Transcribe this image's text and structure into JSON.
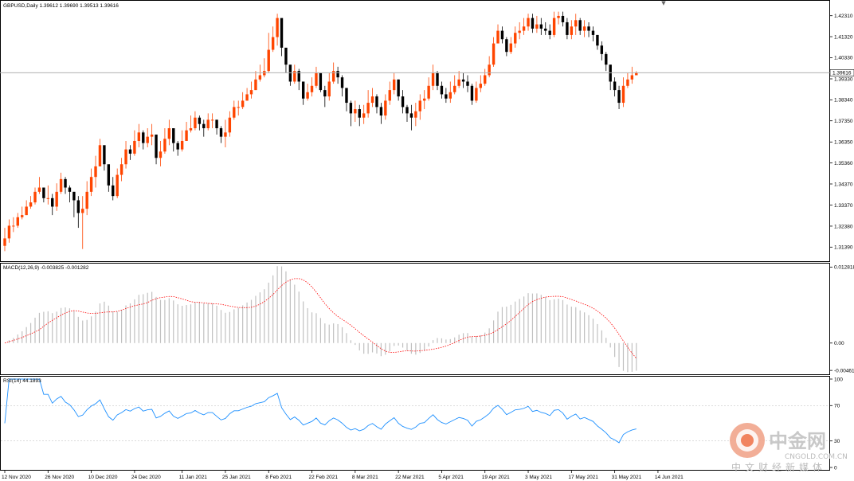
{
  "chart_data": [
    {
      "type": "candlestick",
      "title": "GBPUSD,Daily  1.39612 1.39690 1.39513 1.39616",
      "current_price": 1.39616,
      "current_price_label": "1.39616",
      "ylim": [
        1.308,
        1.429
      ],
      "y_ticks": [
        "1.42310",
        "1.41320",
        "1.40330",
        "1.39330",
        "1.38340",
        "1.37350",
        "1.36350",
        "1.35360",
        "1.34370",
        "1.33370",
        "1.32380",
        "1.31390"
      ],
      "x_ticks": [
        {
          "i": 0,
          "label": "12 Nov 2020"
        },
        {
          "i": 10,
          "label": "26 Nov 2020"
        },
        {
          "i": 20,
          "label": "10 Dec 2020"
        },
        {
          "i": 30,
          "label": "24 Dec 2020"
        },
        {
          "i": 41,
          "label": "11 Jan 2021"
        },
        {
          "i": 51,
          "label": "25 Jan 2021"
        },
        {
          "i": 61,
          "label": "8 Feb 2021"
        },
        {
          "i": 71,
          "label": "22 Feb 2021"
        },
        {
          "i": 81,
          "label": "8 Mar 2021"
        },
        {
          "i": 91,
          "label": "22 Mar 2021"
        },
        {
          "i": 101,
          "label": "5 Apr 2021"
        },
        {
          "i": 111,
          "label": "19 Apr 2021"
        },
        {
          "i": 121,
          "label": "3 May 2021"
        },
        {
          "i": 131,
          "label": "17 May 2021"
        },
        {
          "i": 141,
          "label": "31 May 2021"
        },
        {
          "i": 151,
          "label": "14 Jun 2021"
        }
      ],
      "closes": [
        1.318,
        1.324,
        1.324,
        1.328,
        1.329,
        1.333,
        1.335,
        1.34,
        1.342,
        1.337,
        1.337,
        1.333,
        1.34,
        1.346,
        1.342,
        1.34,
        1.336,
        1.33,
        1.332,
        1.34,
        1.347,
        1.352,
        1.362,
        1.353,
        1.343,
        1.338,
        1.348,
        1.353,
        1.36,
        1.358,
        1.364,
        1.368,
        1.363,
        1.366,
        1.367,
        1.356,
        1.359,
        1.365,
        1.37,
        1.363,
        1.36,
        1.364,
        1.369,
        1.37,
        1.375,
        1.372,
        1.37,
        1.374,
        1.374,
        1.37,
        1.366,
        1.368,
        1.375,
        1.38,
        1.38,
        1.383,
        1.386,
        1.388,
        1.393,
        1.395,
        1.397,
        1.407,
        1.413,
        1.422,
        1.408,
        1.4,
        1.392,
        1.397,
        1.392,
        1.384,
        1.387,
        1.39,
        1.396,
        1.388,
        1.385,
        1.392,
        1.397,
        1.394,
        1.389,
        1.382,
        1.377,
        1.379,
        1.375,
        1.377,
        1.382,
        1.385,
        1.38,
        1.376,
        1.383,
        1.388,
        1.393,
        1.385,
        1.38,
        1.377,
        1.375,
        1.378,
        1.383,
        1.384,
        1.39,
        1.396,
        1.39,
        1.386,
        1.384,
        1.387,
        1.39,
        1.393,
        1.392,
        1.39,
        1.383,
        1.389,
        1.391,
        1.395,
        1.4,
        1.41,
        1.416,
        1.412,
        1.406,
        1.41,
        1.415,
        1.416,
        1.418,
        1.422,
        1.417,
        1.419,
        1.417,
        1.416,
        1.414,
        1.422,
        1.423,
        1.42,
        1.414,
        1.418,
        1.421,
        1.416,
        1.418,
        1.416,
        1.414,
        1.409,
        1.405,
        1.4,
        1.392,
        1.388,
        1.382,
        1.39,
        1.393,
        1.395,
        1.3962
      ],
      "highs": [
        1.323,
        1.327,
        1.328,
        1.33,
        1.333,
        1.336,
        1.338,
        1.342,
        1.347,
        1.342,
        1.343,
        1.339,
        1.344,
        1.349,
        1.347,
        1.343,
        1.34,
        1.338,
        1.338,
        1.345,
        1.351,
        1.357,
        1.365,
        1.36,
        1.351,
        1.347,
        1.351,
        1.356,
        1.364,
        1.362,
        1.369,
        1.372,
        1.369,
        1.37,
        1.372,
        1.362,
        1.364,
        1.37,
        1.374,
        1.369,
        1.364,
        1.369,
        1.373,
        1.376,
        1.378,
        1.376,
        1.374,
        1.377,
        1.377,
        1.374,
        1.371,
        1.374,
        1.378,
        1.383,
        1.383,
        1.387,
        1.389,
        1.392,
        1.397,
        1.4,
        1.403,
        1.415,
        1.418,
        1.424,
        1.418,
        1.405,
        1.398,
        1.4,
        1.398,
        1.39,
        1.391,
        1.394,
        1.399,
        1.396,
        1.39,
        1.396,
        1.401,
        1.399,
        1.395,
        1.389,
        1.383,
        1.383,
        1.381,
        1.381,
        1.388,
        1.389,
        1.386,
        1.382,
        1.386,
        1.392,
        1.396,
        1.393,
        1.388,
        1.381,
        1.381,
        1.382,
        1.386,
        1.388,
        1.394,
        1.4,
        1.397,
        1.392,
        1.389,
        1.392,
        1.395,
        1.397,
        1.396,
        1.395,
        1.391,
        1.392,
        1.395,
        1.398,
        1.404,
        1.413,
        1.419,
        1.418,
        1.413,
        1.413,
        1.418,
        1.42,
        1.422,
        1.424,
        1.424,
        1.423,
        1.422,
        1.42,
        1.419,
        1.425,
        1.425,
        1.425,
        1.422,
        1.421,
        1.424,
        1.422,
        1.421,
        1.42,
        1.418,
        1.414,
        1.411,
        1.406,
        1.4,
        1.394,
        1.39,
        1.394,
        1.396,
        1.399,
        1.3969
      ],
      "lows": [
        1.312,
        1.316,
        1.321,
        1.323,
        1.327,
        1.329,
        1.332,
        1.334,
        1.339,
        1.335,
        1.334,
        1.329,
        1.331,
        1.339,
        1.339,
        1.335,
        1.328,
        1.323,
        1.313,
        1.329,
        1.338,
        1.342,
        1.352,
        1.35,
        1.34,
        1.336,
        1.337,
        1.345,
        1.351,
        1.355,
        1.357,
        1.361,
        1.36,
        1.361,
        1.362,
        1.353,
        1.352,
        1.358,
        1.362,
        1.359,
        1.357,
        1.359,
        1.364,
        1.368,
        1.369,
        1.369,
        1.366,
        1.369,
        1.37,
        1.367,
        1.363,
        1.361,
        1.366,
        1.374,
        1.376,
        1.379,
        1.383,
        1.384,
        1.388,
        1.392,
        1.394,
        1.396,
        1.406,
        1.409,
        1.404,
        1.396,
        1.39,
        1.391,
        1.388,
        1.381,
        1.383,
        1.385,
        1.389,
        1.387,
        1.38,
        1.383,
        1.391,
        1.391,
        1.385,
        1.378,
        1.371,
        1.373,
        1.371,
        1.372,
        1.375,
        1.38,
        1.377,
        1.372,
        1.374,
        1.381,
        1.386,
        1.383,
        1.377,
        1.373,
        1.369,
        1.371,
        1.374,
        1.379,
        1.383,
        1.388,
        1.388,
        1.384,
        1.382,
        1.382,
        1.386,
        1.389,
        1.389,
        1.387,
        1.381,
        1.382,
        1.387,
        1.39,
        1.394,
        1.399,
        1.41,
        1.41,
        1.404,
        1.405,
        1.408,
        1.412,
        1.414,
        1.416,
        1.415,
        1.415,
        1.414,
        1.414,
        1.412,
        1.413,
        1.419,
        1.418,
        1.412,
        1.412,
        1.414,
        1.414,
        1.413,
        1.413,
        1.411,
        1.407,
        1.402,
        1.397,
        1.388,
        1.385,
        1.379,
        1.38,
        1.389,
        1.391,
        1.3951
      ]
    },
    {
      "type": "histogram",
      "title": "MACD(12,26,9) -0.003825 -0.001282",
      "macd_main": -0.003825,
      "macd_signal": -0.001282,
      "ylim": [
        -0.005,
        0.013
      ],
      "y_ticks": [
        "0.012818",
        "0.00",
        "-0.004617"
      ]
    },
    {
      "type": "line",
      "title": "RSI(14) 44.1893",
      "rsi": 44.1893,
      "ylim": [
        0,
        100
      ],
      "y_ticks": [
        "100",
        "70",
        "30",
        "0"
      ]
    }
  ],
  "colors": {
    "bull": "#ff4500",
    "bear": "#000000",
    "macd_bar": "#c0c0c0",
    "macd_signal": "#ff0000",
    "rsi_line": "#1e90ff",
    "grid": "#000000"
  },
  "watermark": {
    "brand_cn": "中金网",
    "domain": "CNGOLD.COM.CN",
    "slogan_cn": "中文财经新媒体"
  },
  "top_indicator": "▼"
}
